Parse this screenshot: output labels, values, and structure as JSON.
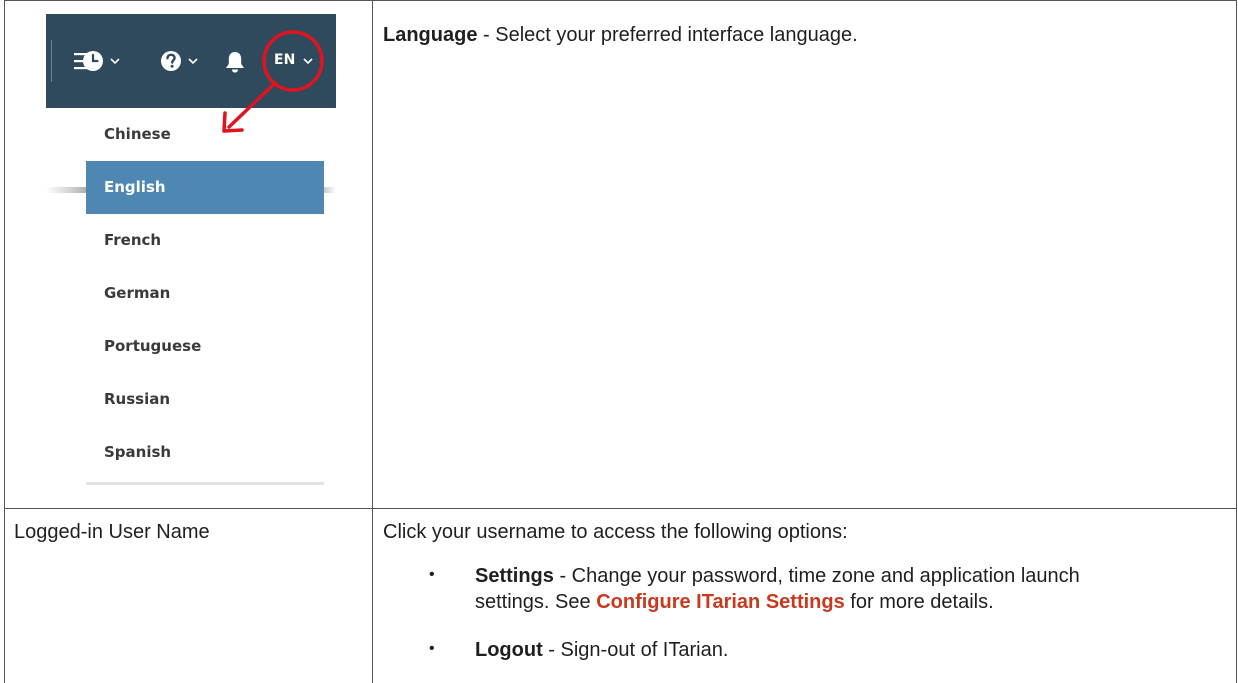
{
  "navbar": {
    "language_code": "EN",
    "icons": [
      "menu-icon",
      "clock-icon",
      "chevron-down-icon",
      "help-icon",
      "chevron-down-icon",
      "bell-icon",
      "chevron-down-icon"
    ]
  },
  "language_menu": {
    "items": [
      "Chinese",
      "English",
      "French",
      "German",
      "Portuguese",
      "Russian",
      "Spanish"
    ],
    "selected": "English"
  },
  "annotation": {
    "highlight_color": "#e0141e"
  },
  "colors": {
    "navbar_bg": "#2f4a5c",
    "selected_bg": "#4e87b2",
    "link": "#c8391f"
  },
  "rows": [
    {
      "term_bold": "Language",
      "description": " - Select your preferred interface language."
    },
    {
      "label": "Logged-in User Name",
      "intro": "Click your username to access the following options:",
      "options": [
        {
          "bold": "Settings",
          "text_before_link": " - Change your password, time zone and application launch",
          "text_line2_before_link": "settings. See ",
          "link": "Configure ITarian Settings",
          "text_after_link": " for more details."
        },
        {
          "bold": "Logout",
          "text": " - Sign-out of ITarian."
        }
      ]
    }
  ]
}
